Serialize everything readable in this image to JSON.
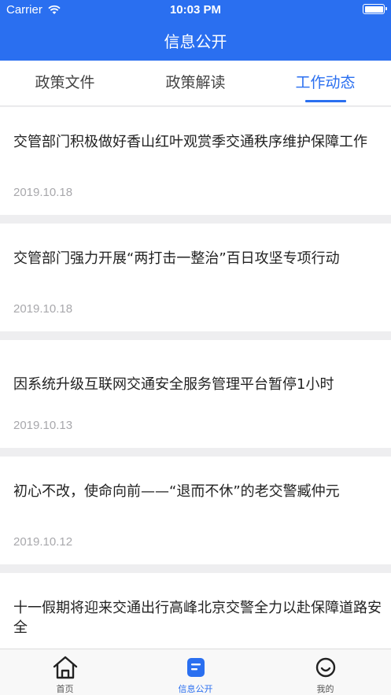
{
  "status_bar": {
    "carrier": "Carrier",
    "time": "10:03 PM"
  },
  "header": {
    "title": "信息公开"
  },
  "tabs": [
    {
      "label": "政策文件",
      "active": false
    },
    {
      "label": "政策解读",
      "active": false
    },
    {
      "label": "工作动态",
      "active": true
    }
  ],
  "news": [
    {
      "title": "交管部门积极做好香山红叶观赏季交通秩序维护保障工作",
      "date": "2019.10.18"
    },
    {
      "title": "交管部门强力开展“两打击一整治”百日攻坚专项行动",
      "date": "2019.10.18"
    },
    {
      "title": "因系统升级互联网交通安全服务管理平台暂停1小时",
      "date": "2019.10.13"
    },
    {
      "title": "初心不改，使命向前——“退而不休”的老交警臧仲元",
      "date": "2019.10.12"
    },
    {
      "title": "十一假期将迎来交通出行高峰北京交警全力以赴保障道路安全",
      "date": ""
    }
  ],
  "tab_bar": [
    {
      "label": "首页",
      "icon": "home-icon",
      "active": false
    },
    {
      "label": "信息公开",
      "icon": "info-document-icon",
      "active": true
    },
    {
      "label": "我的",
      "icon": "smiley-profile-icon",
      "active": false
    }
  ],
  "colors": {
    "accent": "#2a6ff0",
    "background": "#eeeef0",
    "date_text": "#a8a8ac"
  }
}
